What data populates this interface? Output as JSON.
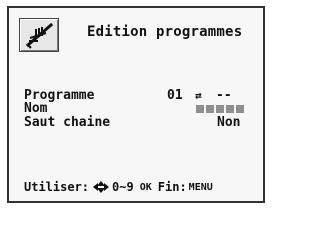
{
  "header": {
    "icon": "programming-icon",
    "title": "Edition programmes"
  },
  "fields": {
    "programme_label": "Programme",
    "programme_value": "01",
    "programme_arrow": "⇄",
    "programme_dash": "--",
    "nom_label": "Nom",
    "saut_label": "Saut chaine",
    "saut_value": "Non"
  },
  "footer": {
    "utiliser": "Utiliser:",
    "range": "0~9",
    "ok": "OK",
    "fin": "Fin:",
    "menu": "MENU"
  }
}
